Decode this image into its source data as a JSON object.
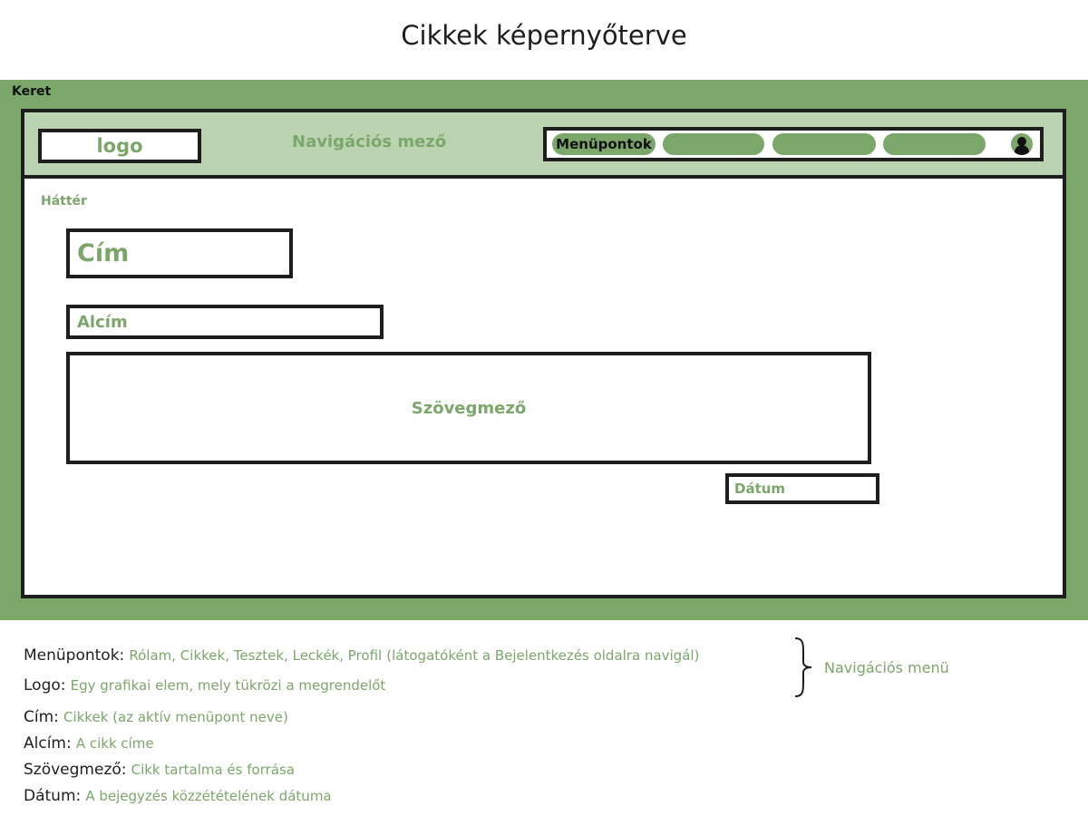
{
  "title": "Cikkek képernyőterve",
  "frame": {
    "label": "Keret"
  },
  "navbar": {
    "logo": "logo",
    "label": "Navigációs mező",
    "menu_label": "Menüpontok",
    "avatar_icon": "user-icon"
  },
  "content": {
    "background_label": "Háttér",
    "title_box": "Cím",
    "subtitle_box": "Alcím",
    "text_box": "Szövegmező",
    "date_box": "Dátum"
  },
  "legend": {
    "items": [
      {
        "term": "Menüpontok:",
        "desc": "Rólam, Cikkek, Tesztek, Leckék, Profil",
        "note": "(látogatóként a Bejelentkezés oldalra navigál)"
      },
      {
        "term": "Logo:",
        "desc": "Egy grafikai elem, mely tükrözi a megrendelőt"
      },
      {
        "term": "Cím:",
        "desc": "Cikkek (az aktív menüpont neve)"
      },
      {
        "term": "Alcím:",
        "desc": "A cikk címe"
      },
      {
        "term": "Szövegmező:",
        "desc": "Cikk tartalma és forrása"
      },
      {
        "term": "Dátum:",
        "desc": "A bejegyzés közzétételének dátuma"
      }
    ],
    "brace_label": "Navigációs menü"
  },
  "colors": {
    "accent": "#7ba76b",
    "nav_bg": "#bcd3b2",
    "border": "#1e1e1e"
  }
}
